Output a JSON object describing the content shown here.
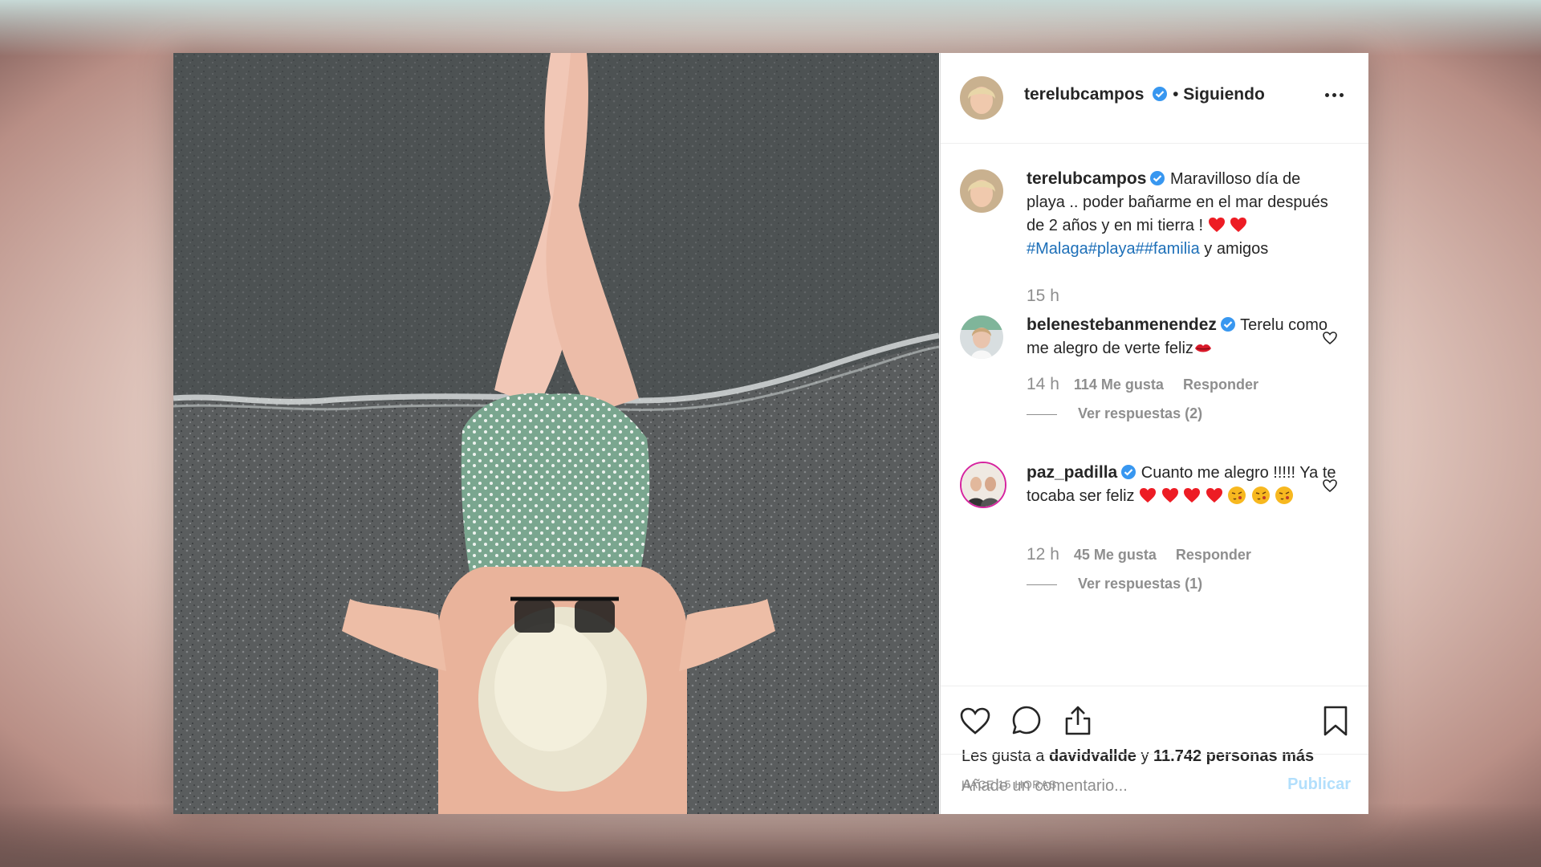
{
  "post": {
    "author": {
      "username": "terelubcampos",
      "verified": true,
      "follow_status": "Siguiendo",
      "separator": "•"
    },
    "caption": {
      "username": "terelubcampos",
      "text_before": " Maravilloso día de playa .. poder bañarme en el mar después de 2 años y en mi tierra ! ",
      "hashtags": [
        "#Malaga",
        "#playa",
        "#",
        "#familia"
      ],
      "text_after": " y amigos",
      "time": "15 h"
    },
    "comments": [
      {
        "username": "belenestebanmenendez",
        "verified": true,
        "text": " Terelu como me alegro de verte feliz",
        "emoji": "kiss-mark-icon",
        "time": "14 h",
        "likes": "114 Me gusta",
        "reply_label": "Responder",
        "view_replies": "Ver respuestas (2)"
      },
      {
        "username": "paz_padilla",
        "verified": true,
        "text": " Cuanto me alegro !!!!! Ya te tocaba ser feliz",
        "emoji": "heart-and-kissing-face-icons",
        "time": "12 h",
        "likes": "45 Me gusta",
        "reply_label": "Responder",
        "view_replies": "Ver respuestas (1)"
      }
    ],
    "likes": {
      "prefix": "Les gusta a ",
      "user": "davidvallde",
      "middle": " y ",
      "count": "11.742 personas más"
    },
    "posted_ago": "HACE 15 HORAS",
    "add_comment": {
      "placeholder": "Añade un comentario...",
      "publish_label": "Publicar"
    }
  },
  "colors": {
    "verified": "#3897f0",
    "hashtag": "#1d6fb8",
    "muted": "#8e8e8e",
    "publish_disabled": "#b2dffc",
    "heart_emoji": "#ed1c24"
  },
  "icons": [
    "more-options-icon",
    "like-icon",
    "comment-icon",
    "share-icon",
    "save-icon",
    "comment-like-icon",
    "verified-icon"
  ]
}
